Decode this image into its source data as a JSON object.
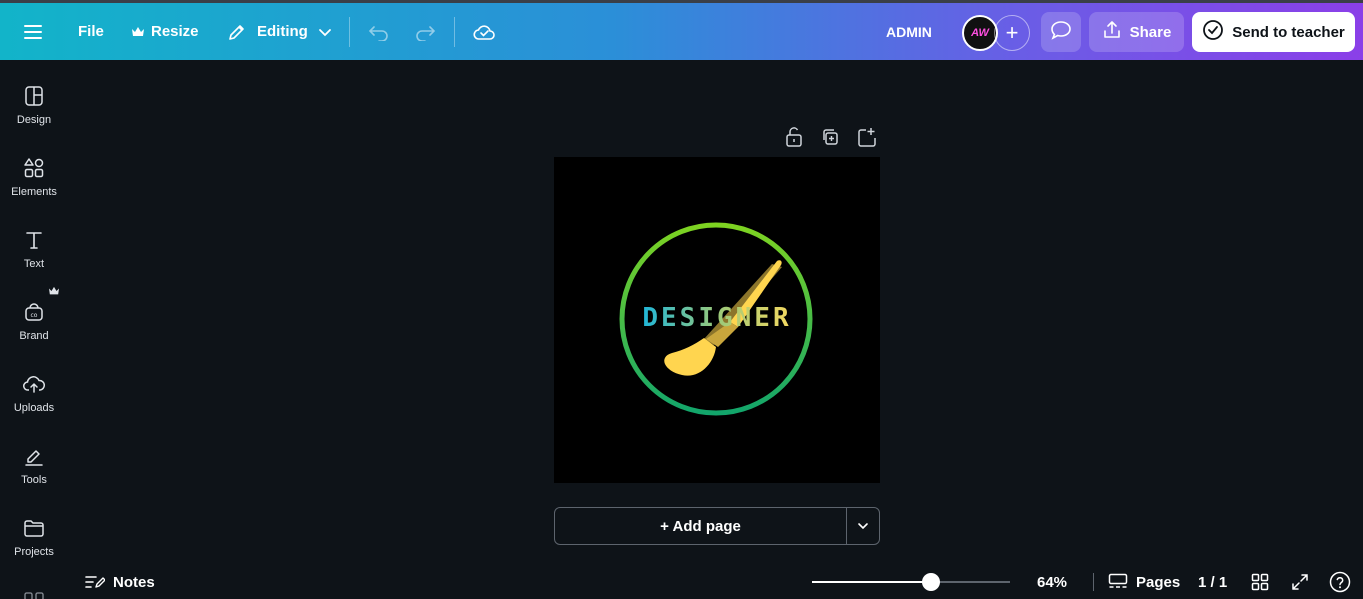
{
  "topbar": {
    "file_label": "File",
    "resize_label": "Resize",
    "editing_label": "Editing",
    "user_label": "ADMIN",
    "avatar_initials": "AW",
    "share_label": "Share",
    "send_label": "Send to teacher"
  },
  "sidebar": {
    "items": [
      {
        "label": "Design",
        "icon": "design-icon"
      },
      {
        "label": "Elements",
        "icon": "elements-icon"
      },
      {
        "label": "Text",
        "icon": "text-icon"
      },
      {
        "label": "Brand",
        "icon": "brand-icon"
      },
      {
        "label": "Uploads",
        "icon": "uploads-icon"
      },
      {
        "label": "Tools",
        "icon": "tools-icon"
      },
      {
        "label": "Projects",
        "icon": "projects-icon"
      }
    ]
  },
  "canvas": {
    "logo_text": "DESIGNER",
    "add_page_label": "+ Add page"
  },
  "bottom": {
    "notes_label": "Notes",
    "zoom_value": 64,
    "zoom_label": "64%",
    "pages_label": "Pages",
    "page_counter": "1 / 1"
  },
  "colors": {
    "accent_gradient_start": "#12b4c9",
    "accent_gradient_end": "#8b3fe8",
    "canvas_bg": "#0e1318",
    "brush_yellow": "#ffd54f",
    "ring_green": "#3cc23a"
  }
}
